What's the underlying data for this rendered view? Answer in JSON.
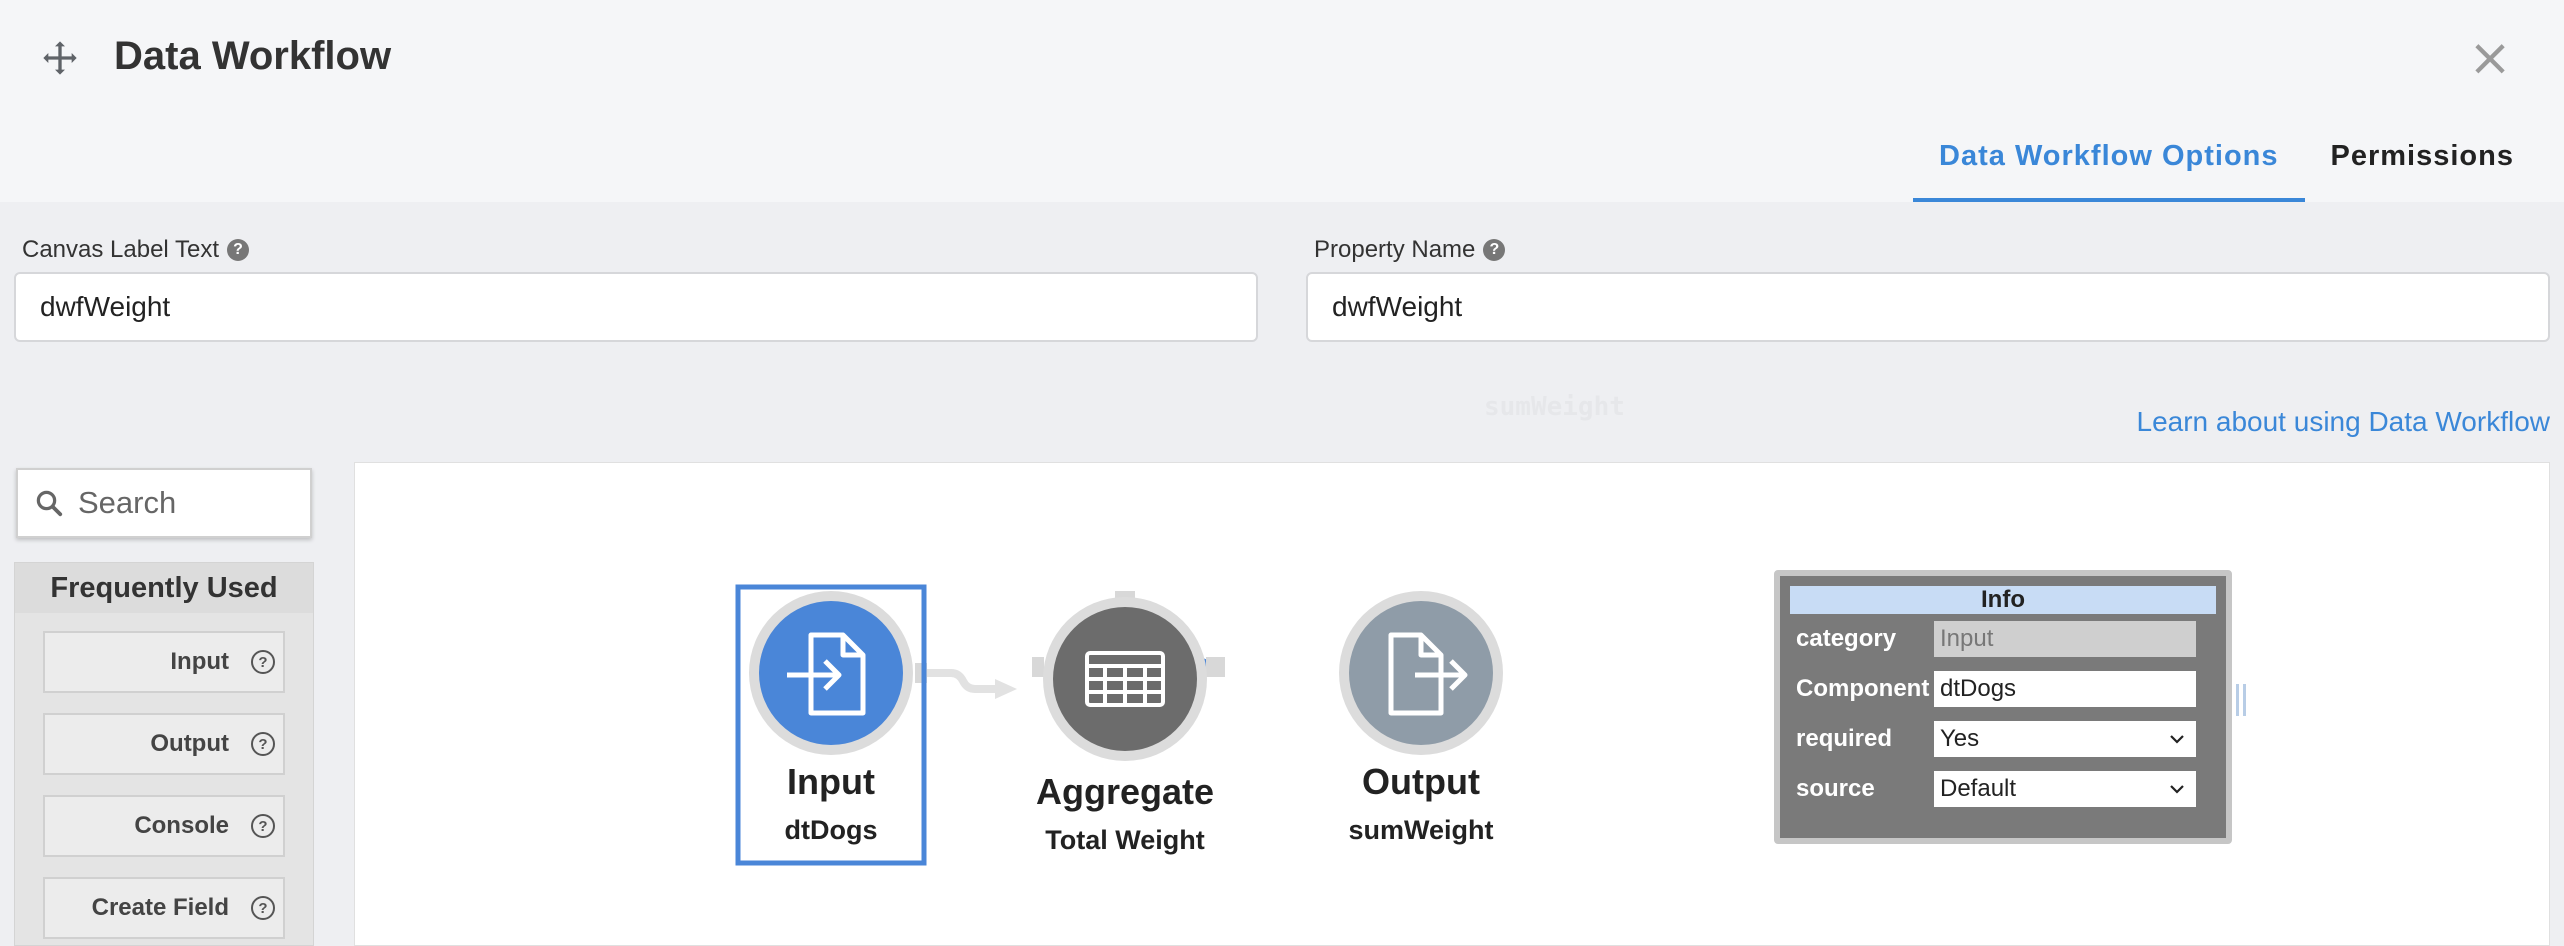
{
  "header": {
    "title": "Data Workflow",
    "tabs": [
      {
        "label": "Data Workflow Options",
        "active": true
      },
      {
        "label": "Permissions",
        "active": false
      }
    ]
  },
  "fields": {
    "canvas_label": {
      "label": "Canvas Label Text",
      "value": "dwfWeight"
    },
    "property_name": {
      "label": "Property Name",
      "value": "dwfWeight"
    }
  },
  "learn_link": "Learn about using Data Workflow",
  "palette": {
    "search_placeholder": "Search",
    "section_title": "Frequently Used",
    "items": [
      "Input",
      "Output",
      "Console",
      "Create Field"
    ]
  },
  "nodes": [
    {
      "name": "Input",
      "sub": "dtDogs",
      "color": "#4a86d8",
      "icon": "file-import-icon",
      "selected": true
    },
    {
      "name": "Aggregate",
      "sub": "Total Weight",
      "color": "#6c6c6c",
      "icon": "table-icon",
      "selected": false
    },
    {
      "name": "Output",
      "sub": "sumWeight",
      "color": "#8f9ca8",
      "icon": "file-export-icon",
      "selected": false
    }
  ],
  "info": {
    "title": "Info",
    "rows": [
      {
        "key": "category",
        "value": "Input",
        "readonly": true,
        "dropdown": false
      },
      {
        "key": "Component",
        "value": "dtDogs",
        "readonly": false,
        "dropdown": false
      },
      {
        "key": "required",
        "value": "Yes",
        "readonly": false,
        "dropdown": true
      },
      {
        "key": "source",
        "value": "Default",
        "readonly": false,
        "dropdown": true
      }
    ]
  },
  "colors": {
    "accent": "#3a87d8",
    "link_active": "#4a86d8"
  }
}
